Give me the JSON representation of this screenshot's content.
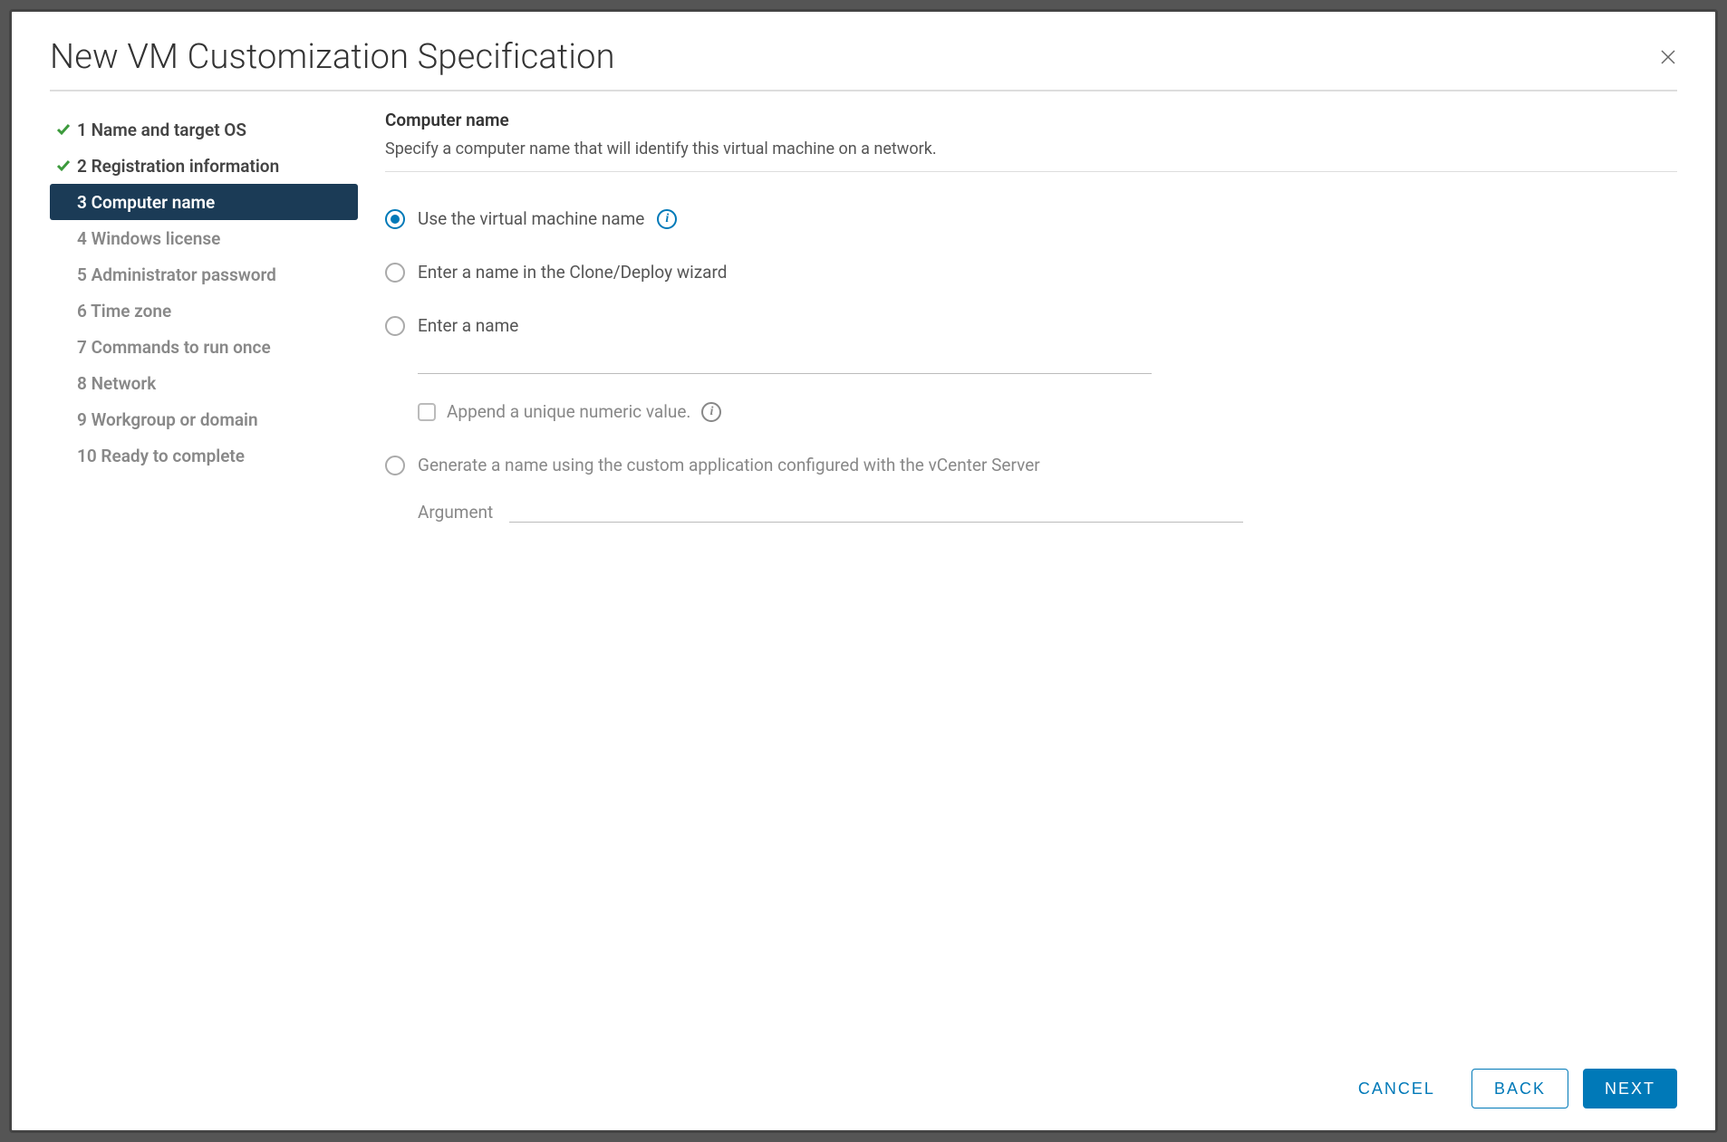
{
  "dialog": {
    "title": "New VM Customization Specification"
  },
  "wizard": {
    "steps": [
      {
        "label": "1 Name and target OS"
      },
      {
        "label": "2 Registration information"
      },
      {
        "label": "3 Computer name"
      },
      {
        "label": "4 Windows license"
      },
      {
        "label": "5 Administrator password"
      },
      {
        "label": "6 Time zone"
      },
      {
        "label": "7 Commands to run once"
      },
      {
        "label": "8 Network"
      },
      {
        "label": "9 Workgroup or domain"
      },
      {
        "label": "10 Ready to complete"
      }
    ]
  },
  "section": {
    "title": "Computer name",
    "description": "Specify a computer name that will identify this virtual machine on a network."
  },
  "options": {
    "use_vm_name": "Use the virtual machine name",
    "enter_in_wizard": "Enter a name in the Clone/Deploy wizard",
    "enter_name": "Enter a name",
    "append_unique": "Append a unique numeric value.",
    "generate_custom": "Generate a name using the custom application configured with the vCenter Server",
    "argument_label": "Argument"
  },
  "footer": {
    "cancel": "CANCEL",
    "back": "BACK",
    "next": "NEXT"
  }
}
